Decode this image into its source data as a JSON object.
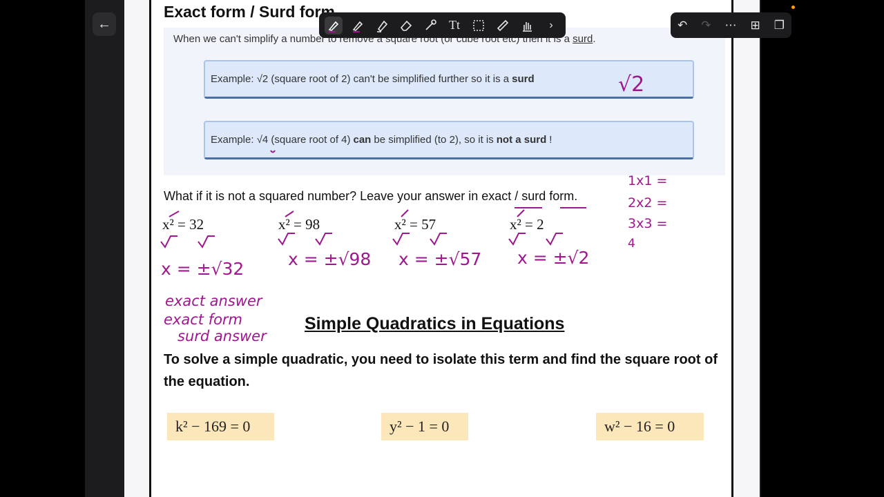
{
  "toolbar": {
    "tools": [
      "pen-icon",
      "pencil-icon",
      "highlighter-icon",
      "eraser-icon",
      "lasso-icon",
      "text-icon",
      "shape-select-icon",
      "ruler-icon",
      "hand-icon",
      "chevron-right-icon"
    ],
    "text_tool_label": "Tt"
  },
  "right_toolbar": {
    "tools": [
      "undo-icon",
      "redo-icon",
      "more-icon",
      "add-page-icon",
      "copy-icon"
    ]
  },
  "document": {
    "title": "Exact form / Surd form",
    "intro_prefix": "When we can't simplify a number to remove a square root (or cube root etc) then it is a",
    "intro_term": "surd",
    "intro_suffix": ".",
    "example1": {
      "prefix": "Example: √2 (square root of 2) can't be simplified further so it is a",
      "bold": "surd"
    },
    "example2": {
      "prefix": "Example: √4 (square root of 4)",
      "bold1": "can",
      "middle": "be simplified (to 2), so it is",
      "bold2": "not a surd",
      "suffix": "!"
    },
    "question": "What if it is not a squared number? Leave your answer in exact / surd form.",
    "equations": [
      "x² = 32",
      "x² = 98",
      "x² = 57",
      "x² = 2"
    ],
    "section_heading": "Simple Quadratics in Equations",
    "instruction": "To solve a simple quadratic, you need to isolate this term and find the square root of the equation.",
    "quadratics": [
      "k² − 169 = 0",
      "y² − 1 = 0",
      "w² − 16 = 0"
    ]
  },
  "annotations": {
    "root2": "√2",
    "answers": [
      "x = ±√32",
      "x = ±√98",
      "x = ±√57",
      "x = ±√2"
    ],
    "notes": [
      "exact answer",
      "exact form",
      "surd answer"
    ],
    "squares": [
      "1x1 =",
      "2x2 =",
      "3x3 =",
      "4"
    ]
  },
  "colors": {
    "ink": "#a0168f",
    "example_bg": "#dde9fb",
    "quad_bg": "#fbe7b9"
  }
}
